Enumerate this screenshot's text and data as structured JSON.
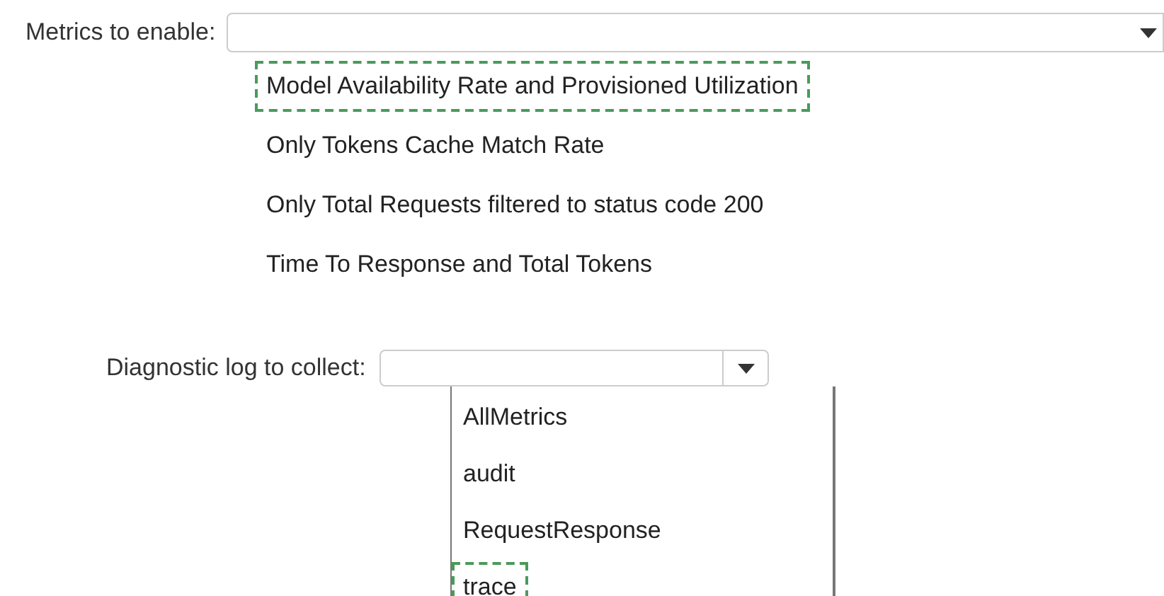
{
  "dropdowns": [
    {
      "label": "Metrics to enable:",
      "options": [
        {
          "label": "Model Availability Rate and Provisioned Utilization",
          "selected": true
        },
        {
          "label": "Only Tokens Cache Match Rate",
          "selected": false
        },
        {
          "label": "Only Total Requests filtered to status code 200",
          "selected": false
        },
        {
          "label": "Time To Response and Total Tokens",
          "selected": false
        }
      ]
    },
    {
      "label": "Diagnostic log to collect:",
      "options": [
        {
          "label": "AllMetrics",
          "selected": false
        },
        {
          "label": "audit",
          "selected": false
        },
        {
          "label": "RequestResponse",
          "selected": false
        },
        {
          "label": "trace",
          "selected": true
        }
      ]
    }
  ]
}
